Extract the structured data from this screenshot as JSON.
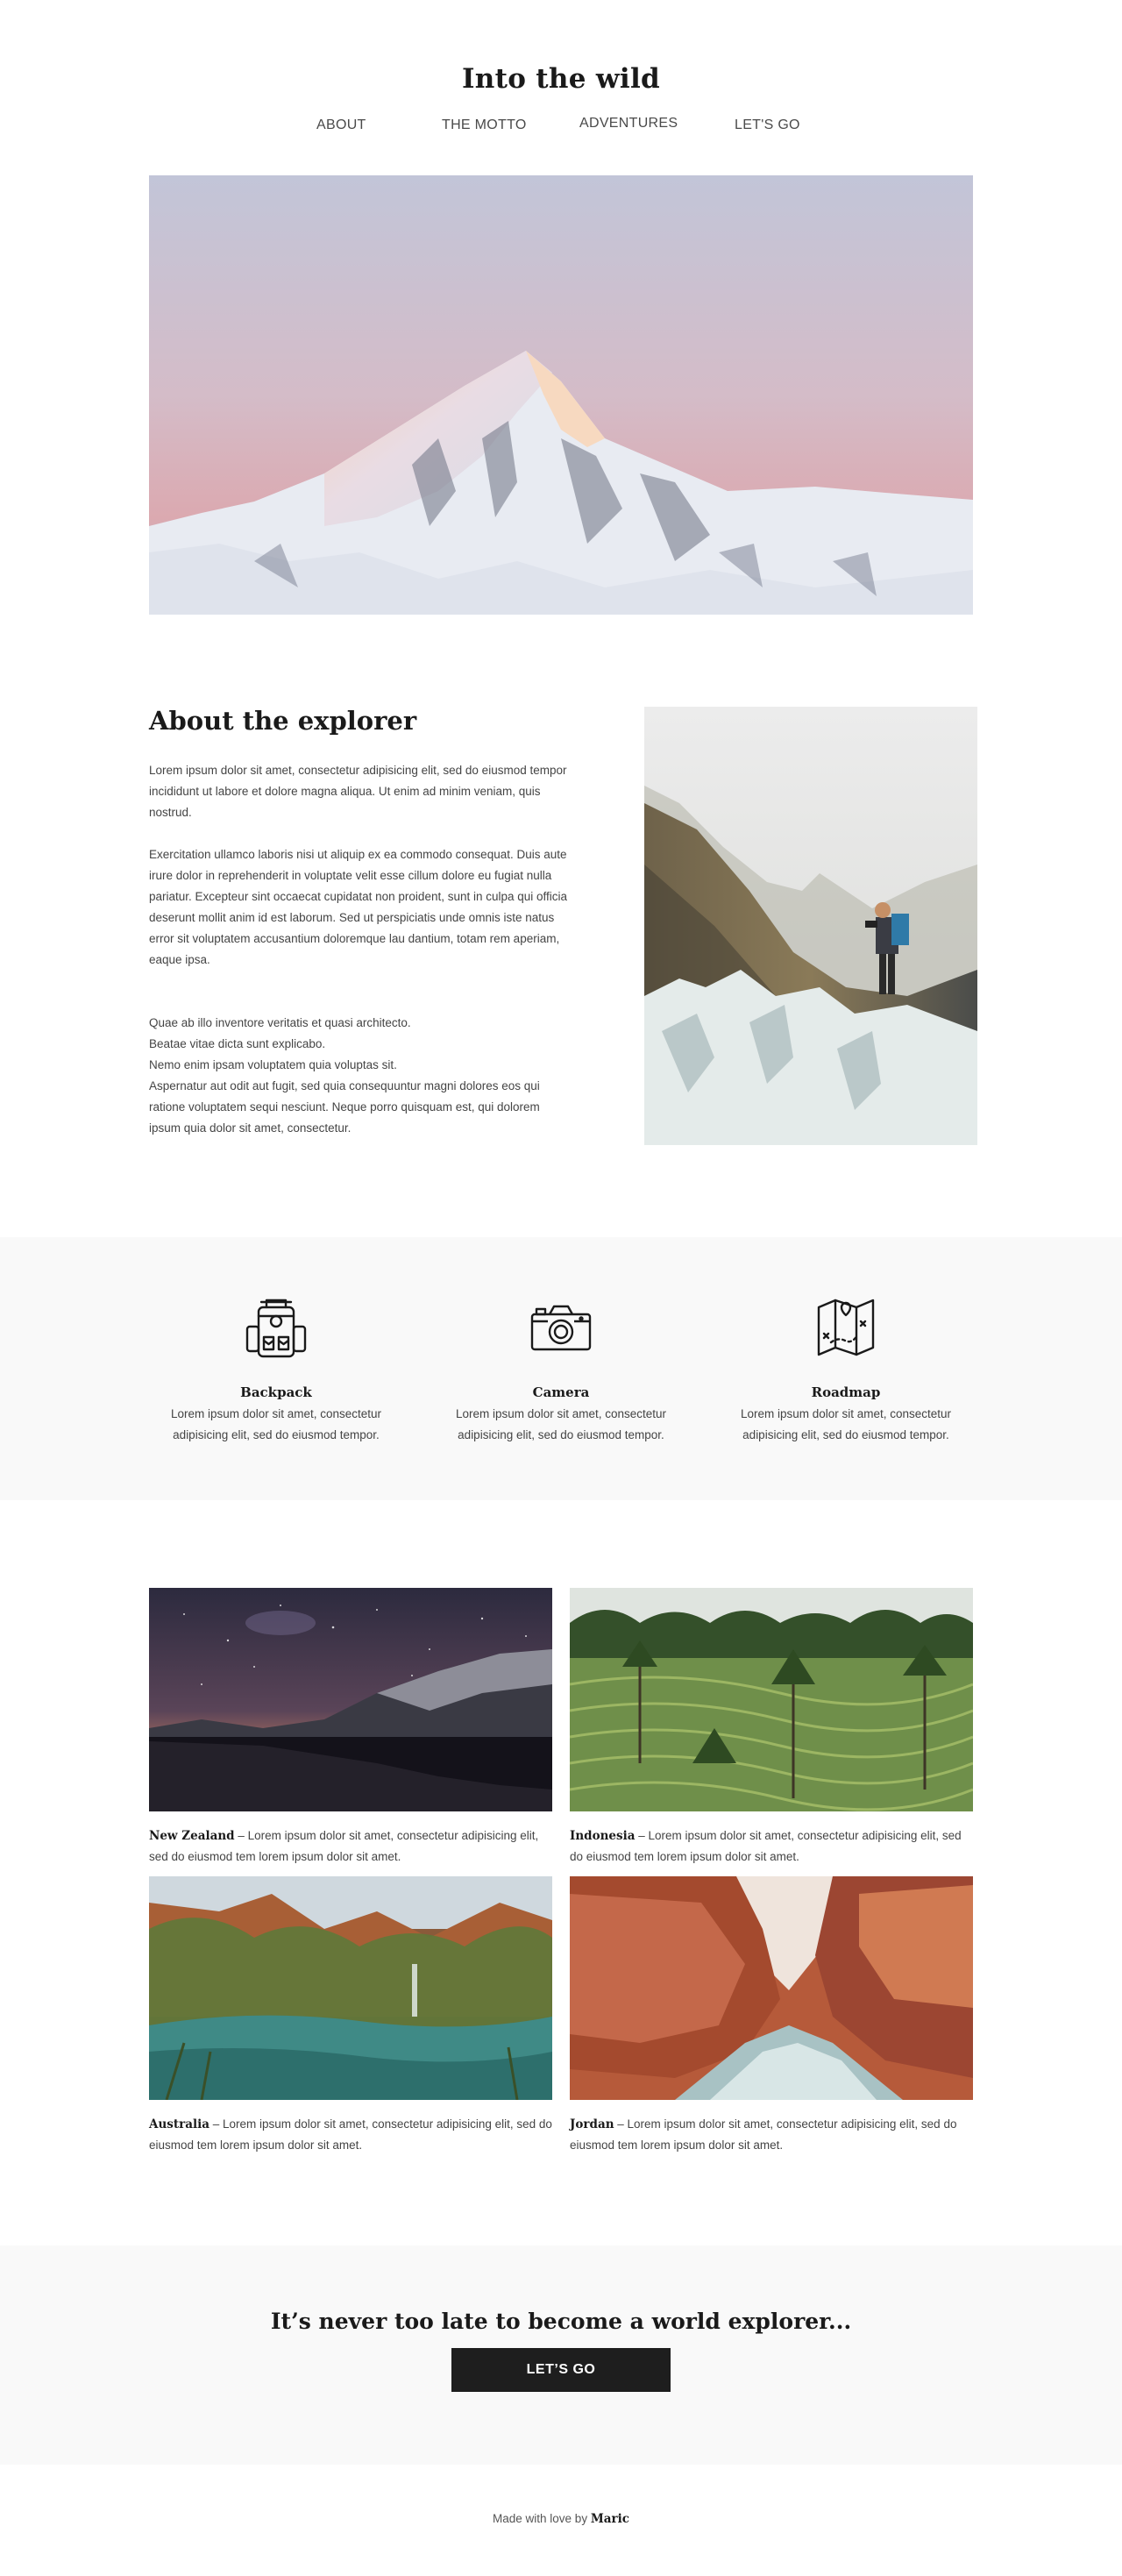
{
  "header": {
    "title": "Into the wild"
  },
  "nav": {
    "items": [
      "ABOUT",
      "THE MOTTO",
      "ADVENTURES",
      "LET'S GO"
    ]
  },
  "about": {
    "heading": "About the explorer",
    "p1": "Lorem ipsum dolor sit amet, consectetur adipisicing elit, sed do eiusmod tempor incididunt ut labore et dolore magna aliqua. Ut enim ad minim veniam, quis nostrud.",
    "p2": "Exercitation ullamco laboris nisi ut aliquip ex ea commodo consequat. Duis aute irure dolor in reprehenderit in voluptate velit esse cillum dolore eu fugiat nulla pariatur. Excepteur sint occaecat cupidatat non proident, sunt in culpa qui officia deserunt mollit anim id est laborum. Sed ut perspiciatis unde omnis iste natus error sit voluptatem accusantium doloremque lau dantium, totam rem aperiam, eaque ipsa.",
    "lines": [
      "Quae ab illo inventore veritatis et quasi architecto.",
      "Beatae vitae dicta sunt explicabo.",
      "Nemo enim ipsam voluptatem quia voluptas sit.",
      "Aspernatur aut odit aut fugit, sed quia consequuntur magni dolores eos qui ratione voluptatem sequi nesciunt. Neque porro quisquam est, qui dolorem ipsum quia dolor sit amet, consectetur."
    ]
  },
  "features": [
    {
      "icon": "backpack-icon",
      "title": "Backpack",
      "text": "Lorem ipsum dolor sit amet, consectetur adipisicing elit, sed do eiusmod tempor."
    },
    {
      "icon": "camera-icon",
      "title": "Camera",
      "text": "Lorem ipsum dolor sit amet, consectetur adipisicing elit, sed do eiusmod tempor."
    },
    {
      "icon": "map-icon",
      "title": "Roadmap",
      "text": "Lorem ipsum dolor sit amet, consectetur adipisicing elit, sed do eiusmod tempor."
    }
  ],
  "gallery": [
    {
      "place": "New Zealand",
      "text": " – Lorem ipsum dolor sit amet, consectetur adipisicing elit, sed do eiusmod tem lorem ipsum dolor sit amet."
    },
    {
      "place": "Indonesia",
      "text": " – Lorem ipsum dolor sit amet, consectetur adipisicing elit, sed do eiusmod tem lorem ipsum dolor sit amet."
    },
    {
      "place": "Australia",
      "text": " – Lorem ipsum dolor sit amet, consectetur adipisicing elit, sed do eiusmod tem lorem ipsum dolor sit amet."
    },
    {
      "place": "Jordan",
      "text": " – Lorem ipsum dolor sit amet, consectetur adipisicing elit, sed do eiusmod tem lorem ipsum dolor sit amet."
    }
  ],
  "cta": {
    "heading": "It’s never too late to become a world explorer...",
    "button": "LET’S GO"
  },
  "footer": {
    "prefix": "Made with love by ",
    "author": "Maric"
  },
  "colors": {
    "dark": "#1e1e1e",
    "section_bg": "#f9f9f9",
    "text": "#444444"
  }
}
